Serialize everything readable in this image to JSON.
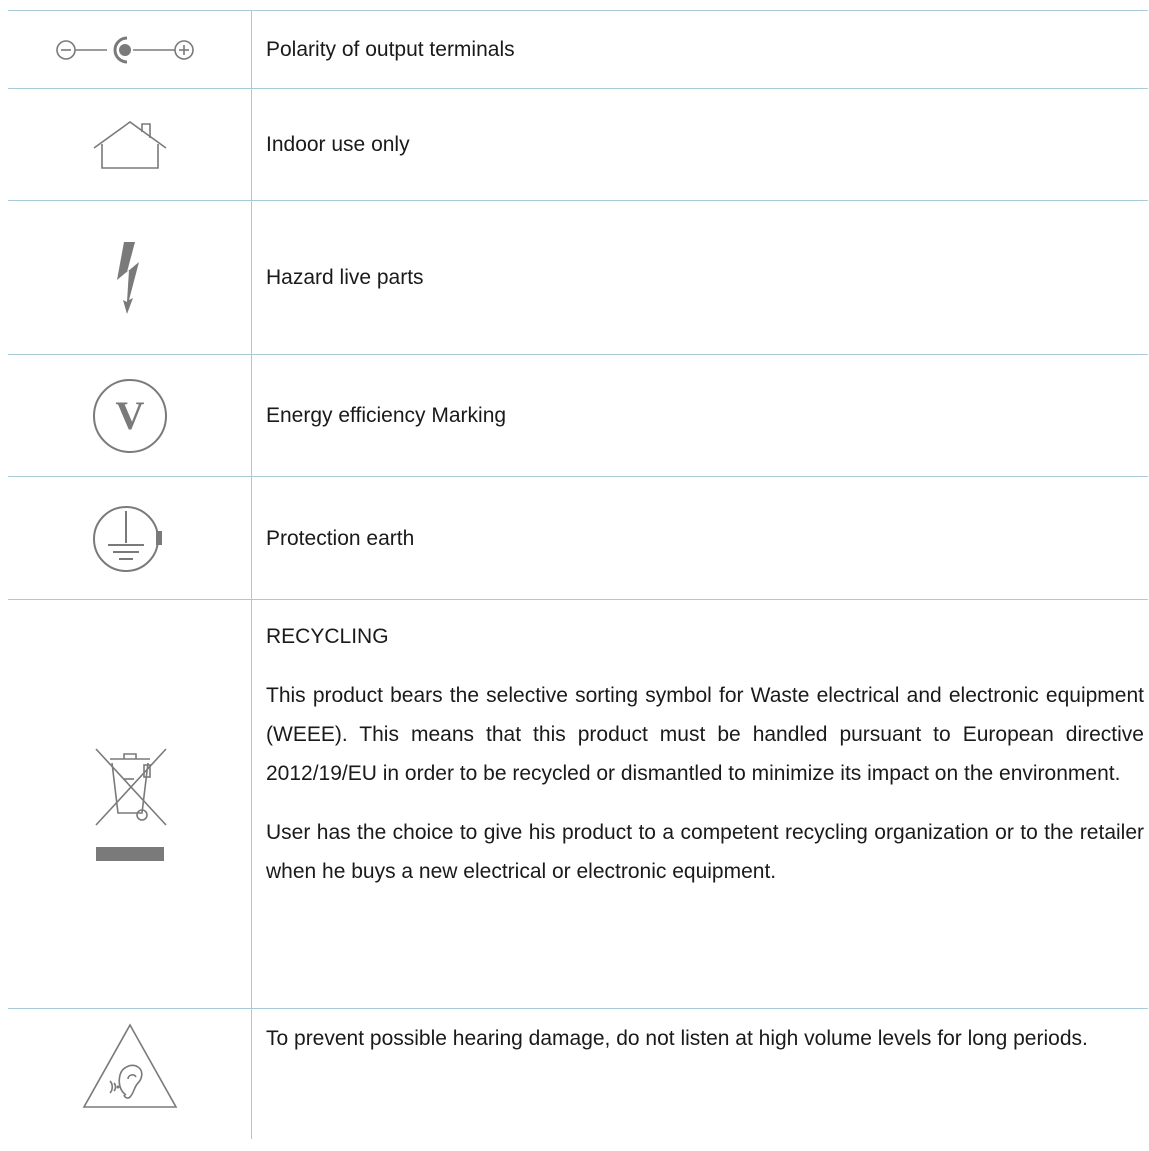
{
  "rows": [
    {
      "icon": "dc-polarity-icon",
      "text": "Polarity of output terminals"
    },
    {
      "icon": "indoor-house-icon",
      "text": "Indoor use only"
    },
    {
      "icon": "lightning-bolt-icon",
      "text": "Hazard live parts"
    },
    {
      "icon": "energy-efficiency-v-icon",
      "text": "Energy efficiency Marking"
    },
    {
      "icon": "protective-earth-icon",
      "text": "Protection earth"
    }
  ],
  "recycling": {
    "icon": "crossed-out-bin-icon",
    "title": "RECYCLING",
    "paragraph1": "This product bears the selective sorting symbol for Waste electrical and electronic equipment (WEEE). This means that this product must be handled pursuant to European directive 2012/19/EU in order to be recycled or dismantled to minimize its impact on the environment.",
    "paragraph2": "User has the choice to give his product to a competent recycling organization or to the retailer when he buys a new electrical or electronic equipment."
  },
  "hearing": {
    "icon": "hearing-warning-icon",
    "text": "To prevent possible hearing damage, do not listen at high volume levels for long periods."
  },
  "colors": {
    "rule": "#a9cbd8",
    "icon": "#7a7a7a",
    "text": "#1a1a1a"
  }
}
